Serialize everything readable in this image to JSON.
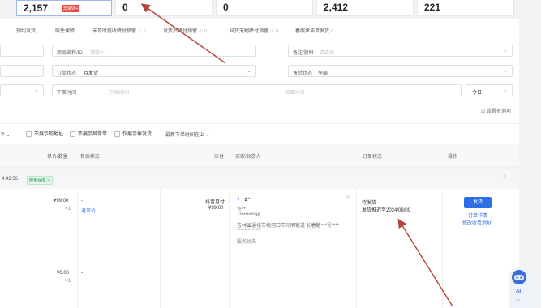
{
  "stats": {
    "card1_value": "2,157",
    "card1_badge": "异常99+",
    "card2_value": "0",
    "card3_value": "0",
    "card4_value": "2,412",
    "card5_value": "221"
  },
  "tabs": [
    {
      "label": "预约发货",
      "count": ""
    },
    {
      "label": "赔免保障",
      "count": ""
    },
    {
      "label": "未及时揽收降付预警",
      "count": "0"
    },
    {
      "label": "发货后降付预警",
      "count": "0"
    },
    {
      "label": "缺货无物降付预警",
      "count": "0"
    },
    {
      "label": "春假承诺单发货",
      "count": "0"
    }
  ],
  "filters": {
    "product_label": "商品名称/ID",
    "product_placeholder": "请输入",
    "remark_label": "备注/旗帜",
    "remark_placeholder": "请选择",
    "order_status_label": "订单状态",
    "order_status_value": "待发货",
    "aftersale_label": "售后状态",
    "aftersale_value": "全部",
    "time_label": "下单时间",
    "start_placeholder": "开始时间",
    "end_placeholder": "结束时间",
    "today": "今日",
    "save_query": "设置查询项"
  },
  "toolbar": {
    "opt1": "不展示现地址",
    "opt2": "不展示异常单",
    "opt3": "仅展示催发货",
    "sort": "最新下单时间在上"
  },
  "table": {
    "headers": [
      "单价/数量",
      "售后状态",
      "应付",
      "买家/收货人",
      "订单状态",
      "操作"
    ],
    "group_time": "4:42:56",
    "group_tag": "赔免保障",
    "row1": {
      "price": "¥99.00",
      "qty": "×1",
      "aftersale": "退差价",
      "aftersale_dash": "-",
      "pay_label": "抖音月付",
      "pay_amount": "¥99.00",
      "buyer": "✿*",
      "receiver": "许**",
      "phone": "1********36",
      "address1": "吉林省通化市梅河口市光明街道 长春路***号****",
      "address2": "************",
      "service": "服务优先",
      "status": "待发货",
      "deadline": "发货推迟至2024/08/09",
      "ship_btn": "发货",
      "detail_link": "订单详情",
      "addr_link": "修改收货地址"
    },
    "row2": {
      "price": "¥0.00",
      "qty": "×1",
      "aftersale_dash": "-"
    }
  },
  "assistant": {
    "label": "AI"
  }
}
